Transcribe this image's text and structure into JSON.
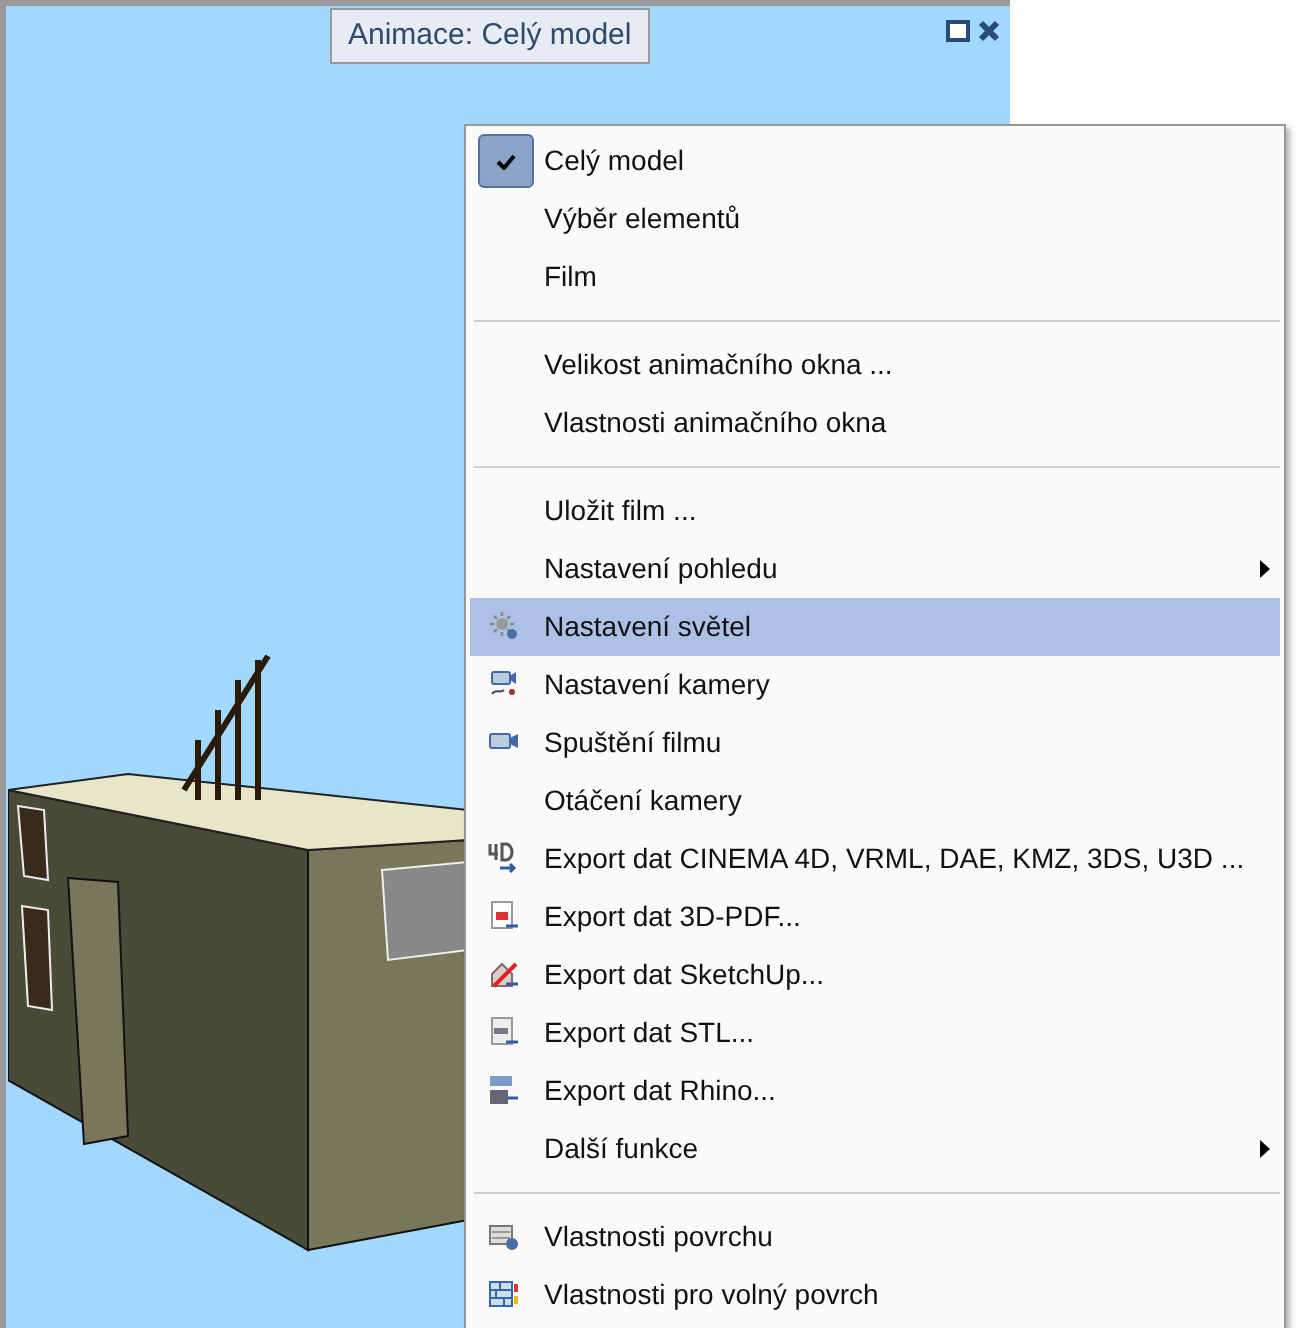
{
  "viewport": {
    "title": "Animace: Celý model"
  },
  "menu": [
    {
      "kind": "item",
      "label": "Celý model",
      "checked": true,
      "selected": false,
      "submenu": false
    },
    {
      "kind": "item",
      "label": "Výběr elementů",
      "checked": false,
      "selected": false,
      "submenu": false
    },
    {
      "kind": "item",
      "label": "Film",
      "checked": false,
      "selected": false,
      "submenu": false
    },
    {
      "kind": "separator"
    },
    {
      "kind": "item",
      "label": "Velikost animačního okna ...",
      "selected": false,
      "submenu": false
    },
    {
      "kind": "item",
      "label": "Vlastnosti animačního okna",
      "selected": false,
      "submenu": false
    },
    {
      "kind": "separator"
    },
    {
      "kind": "item",
      "label": "Uložit film ...",
      "selected": false,
      "submenu": false
    },
    {
      "kind": "item",
      "label": "Nastavení pohledu",
      "selected": false,
      "submenu": true
    },
    {
      "kind": "item",
      "label": "Nastavení světel",
      "selected": true,
      "submenu": false
    },
    {
      "kind": "item",
      "label": "Nastavení kamery",
      "selected": false,
      "submenu": false
    },
    {
      "kind": "item",
      "label": "Spuštění filmu",
      "selected": false,
      "submenu": false
    },
    {
      "kind": "item",
      "label": "Otáčení kamery",
      "selected": false,
      "submenu": false
    },
    {
      "kind": "item",
      "label": "Export dat CINEMA 4D, VRML, DAE, KMZ, 3DS, U3D ...",
      "selected": false,
      "submenu": false
    },
    {
      "kind": "item",
      "label": "Export dat 3D-PDF...",
      "selected": false,
      "submenu": false
    },
    {
      "kind": "item",
      "label": "Export dat SketchUp...",
      "selected": false,
      "submenu": false
    },
    {
      "kind": "item",
      "label": "Export dat STL...",
      "selected": false,
      "submenu": false
    },
    {
      "kind": "item",
      "label": "Export dat Rhino...",
      "selected": false,
      "submenu": false
    },
    {
      "kind": "item",
      "label": "Další funkce",
      "selected": false,
      "submenu": true
    },
    {
      "kind": "separator"
    },
    {
      "kind": "item",
      "label": "Vlastnosti povrchu",
      "selected": false,
      "submenu": false
    },
    {
      "kind": "item",
      "label": "Vlastnosti pro volný povrch",
      "selected": false,
      "submenu": false
    }
  ]
}
